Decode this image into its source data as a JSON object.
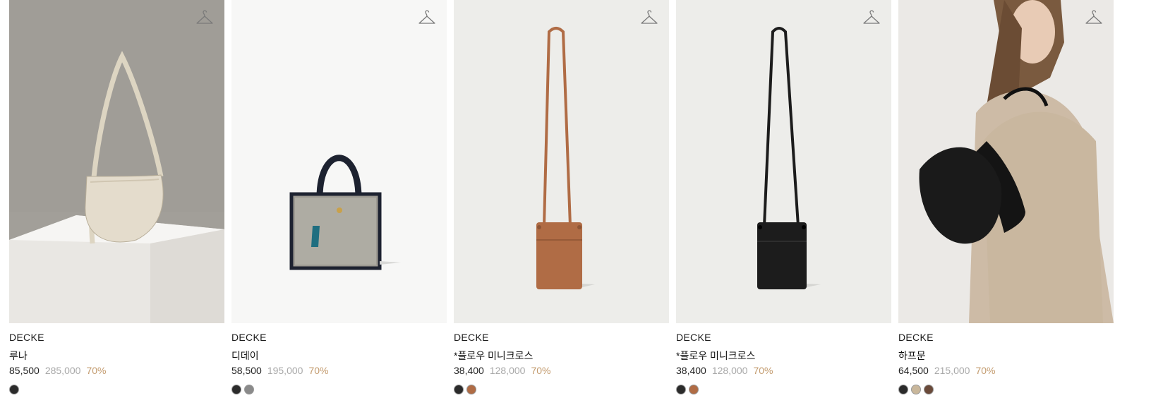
{
  "products": [
    {
      "brand": "DECKE",
      "name": "루나",
      "sale_price": "85,500",
      "original_price": "285,000",
      "discount": "70%",
      "icon": "hanger-icon",
      "bg_color": "#a29f99",
      "item_color": "#e3dccb",
      "swatches": [
        "#2b2b2b"
      ]
    },
    {
      "brand": "DECKE",
      "name": "디데이",
      "sale_price": "58,500",
      "original_price": "195,000",
      "discount": "70%",
      "icon": "hanger-icon",
      "bg_color": "#f7f7f6",
      "item_color": "#1f2430",
      "swatches": [
        "#2b2b2b",
        "#8a8a8a"
      ]
    },
    {
      "brand": "DECKE",
      "name": "*플로우 미니크로스",
      "sale_price": "38,400",
      "original_price": "128,000",
      "discount": "70%",
      "icon": "hanger-icon",
      "bg_color": "#ededea",
      "item_color": "#b06c45",
      "swatches": [
        "#2b2b2b",
        "#b06c45"
      ]
    },
    {
      "brand": "DECKE",
      "name": "*플로우 미니크로스",
      "sale_price": "38,400",
      "original_price": "128,000",
      "discount": "70%",
      "icon": "hanger-icon",
      "bg_color": "#ededea",
      "item_color": "#1c1c1c",
      "swatches": [
        "#2b2b2b",
        "#b06c45"
      ]
    },
    {
      "brand": "DECKE",
      "name": "하프문",
      "sale_price": "64,500",
      "original_price": "215,000",
      "discount": "70%",
      "icon": "hanger-icon",
      "bg_color": "#d9cfc2",
      "item_color": "#1a1a1a",
      "swatches": [
        "#2b2b2b",
        "#c9b79b",
        "#6a4a3a"
      ]
    }
  ],
  "colors": {
    "discount": "#c39b6e",
    "original_price": "#a8a8a8"
  }
}
